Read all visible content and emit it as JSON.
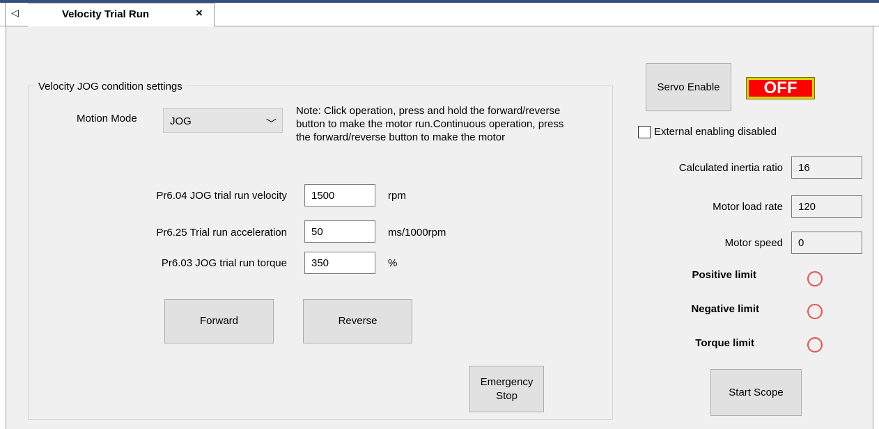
{
  "tab": {
    "title": "Velocity Trial Run",
    "close_glyph": "×",
    "scroll_glyph": "◁"
  },
  "group": {
    "legend": "Velocity  JOG  condition settings"
  },
  "motion_mode": {
    "label": "Motion Mode",
    "value": "JOG",
    "arrow": "﹀"
  },
  "note": "Note: Click operation, press and hold the forward/reverse button to make the motor run.Continuous operation, press the forward/reverse button to make the motor",
  "params": [
    {
      "label": "Pr6.04 JOG trial run velocity",
      "value": "1500",
      "unit": "rpm"
    },
    {
      "label": "Pr6.25 Trial run acceleration",
      "value": "50",
      "unit": "ms/1000rpm"
    },
    {
      "label": "Pr6.03 JOG trial run torque",
      "value": "350",
      "unit": "%"
    }
  ],
  "buttons": {
    "forward": "Forward",
    "reverse": "Reverse",
    "emergency_line1": "Emergency",
    "emergency_line2": "Stop",
    "servo_enable": "Servo Enable",
    "start_scope": "Start Scope"
  },
  "servo_status": {
    "text": "OFF",
    "color": "#ff0000"
  },
  "external_enable": {
    "label": "External enabling disabled",
    "checked": false
  },
  "monitors": [
    {
      "label": "Calculated inertia ratio",
      "value": "16"
    },
    {
      "label": "Motor load rate",
      "value": "120"
    },
    {
      "label": "Motor speed",
      "value": "0"
    }
  ],
  "limits": [
    {
      "label": "Positive limit",
      "active": false
    },
    {
      "label": "Negative limit",
      "active": false
    },
    {
      "label": "Torque limit",
      "active": false
    }
  ],
  "colors": {
    "lamp_off": "#e8504c",
    "header_bar": "#35507a"
  }
}
